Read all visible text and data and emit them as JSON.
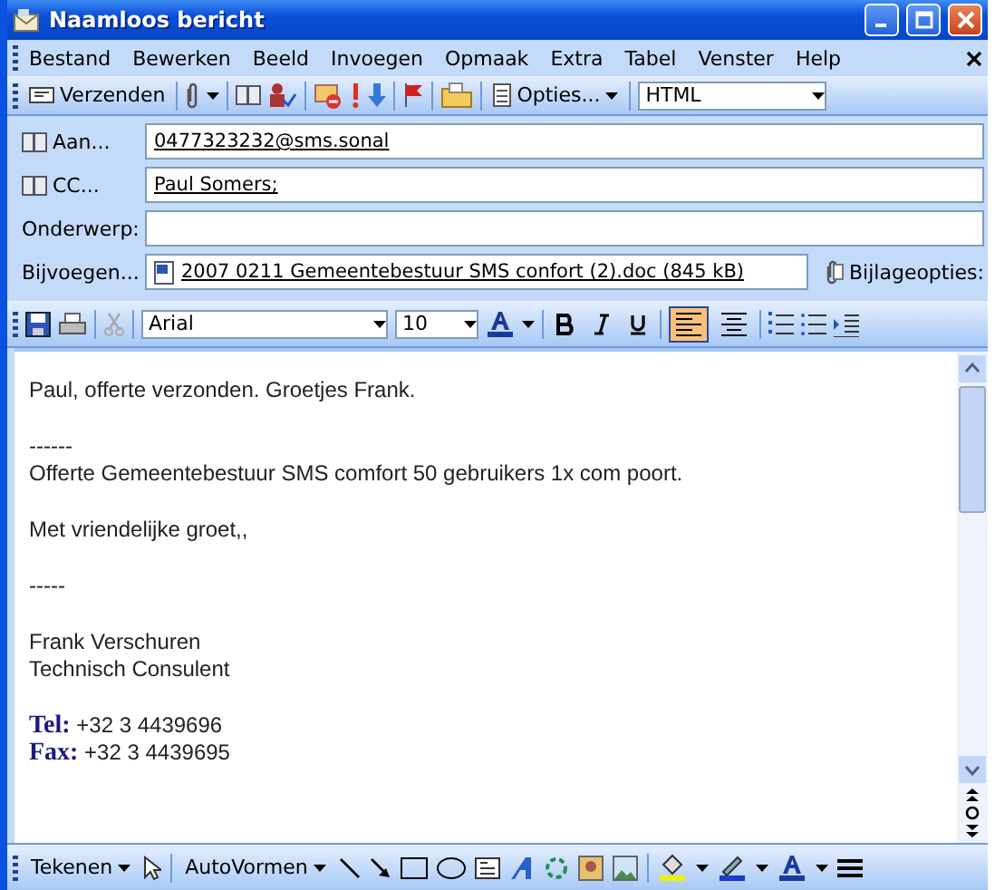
{
  "window": {
    "title": "Naamloos bericht"
  },
  "menu": [
    "Bestand",
    "Bewerken",
    "Beeld",
    "Invoegen",
    "Opmaak",
    "Extra",
    "Tabel",
    "Venster",
    "Help"
  ],
  "toolbar": {
    "send": "Verzenden",
    "options": "Opties...",
    "format": "HTML"
  },
  "fields": [
    {
      "kind": "address",
      "label": "Aan...",
      "value": "0477323232@sms.sonal"
    },
    {
      "kind": "address",
      "label": "CC...",
      "value": "Paul Somers;"
    },
    {
      "kind": "text",
      "label": "Onderwerp:"
    },
    {
      "kind": "attachment",
      "label": "Bijvoegen...",
      "value": "2007 0211 Gemeentebestuur SMS confort (2).doc (845 kB)",
      "options": "Bijlageopties:"
    }
  ],
  "format_bar": {
    "font": "Arial",
    "size": "10",
    "align_buttons": [
      {
        "kind": "left",
        "selected": true
      },
      {
        "kind": "center",
        "selected": false
      }
    ]
  },
  "body": {
    "paragraphs": [
      {
        "kind": "text",
        "text": "Paul, offerte verzonden. Groetjes Frank."
      },
      {
        "kind": "gap"
      },
      {
        "kind": "text",
        "text": "------"
      },
      {
        "kind": "text",
        "text": "Offerte Gemeentebestuur SMS comfort 50 gebruikers 1x com poort."
      },
      {
        "kind": "gap"
      },
      {
        "kind": "text",
        "text": "Met vriendelijke groet,,"
      },
      {
        "kind": "gap"
      },
      {
        "kind": "text",
        "text": "-----"
      },
      {
        "kind": "gap"
      },
      {
        "kind": "text",
        "text": "Frank Verschuren"
      },
      {
        "kind": "text",
        "text": "Technisch Consulent"
      },
      {
        "kind": "gap"
      },
      {
        "kind": "contact",
        "text": "**Tel:** +32 3 4439696"
      },
      {
        "kind": "contact",
        "text": "**Fax:** +32 3 4439695"
      }
    ]
  },
  "draw_bar": {
    "draw": "Tekenen",
    "autoshapes": "AutoVormen"
  }
}
